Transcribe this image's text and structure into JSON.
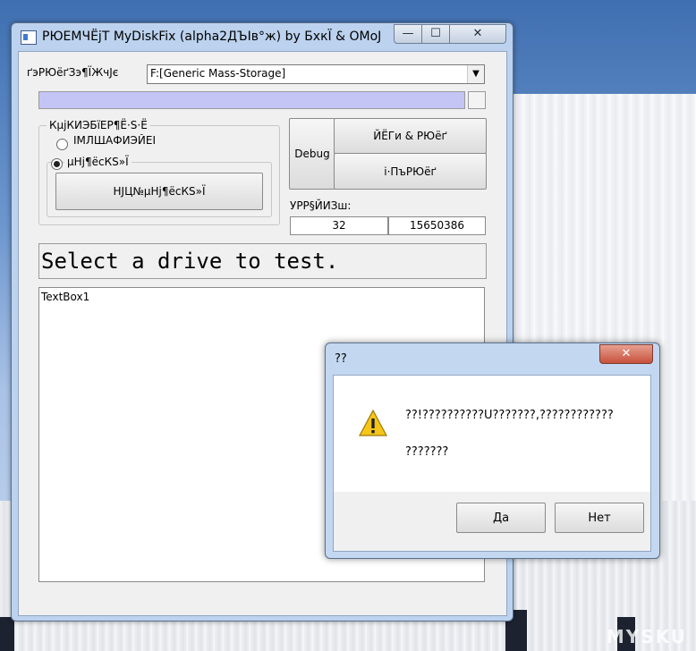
{
  "main_window": {
    "title": "РЮЕМЧЁјТ MyDiskFix (alpha2ДЪІв°ж) by БхкЇ & OMoJ",
    "caption_buttons": {
      "minimize": "—",
      "maximize": "☐",
      "close": "✕"
    },
    "device_label": "ґэРЮёґЗэ¶ЇЖчЈє",
    "device_select": "F:[Generic Mass-Storage]",
    "progress_fraction": 0.0,
    "group_title": "КµјКИЭБїЕР¶Ё·S·Ё",
    "radio_option_1": "ІМЛЩАФИЭЙЕІ",
    "radio_option_2": "µНј¶ёсКS»Ї",
    "format_button": "НЈЦ№µНј¶ёсКS»Ї",
    "debug_button": "Debug",
    "action_button_1": "ЙЁГи & РЮёґ",
    "action_button_2": "і·ПъРЮёґ",
    "capacity_label": "УРР§ЙИЗш:",
    "field_value_1": "32",
    "field_value_2": "15650386",
    "status_text": "Select a drive to test.",
    "textbox_text": "TextBox1"
  },
  "dialog": {
    "title": "??",
    "close": "✕",
    "message_line_1": "??!??????????U???????,????????????",
    "message_line_2": "???????",
    "yes_button": "Да",
    "no_button": "Нет",
    "icon": "warning-icon"
  },
  "watermark": "MYSKU",
  "colors": {
    "progress_fill": "#c4c4f5",
    "window_frame": "#bcd2ee"
  }
}
